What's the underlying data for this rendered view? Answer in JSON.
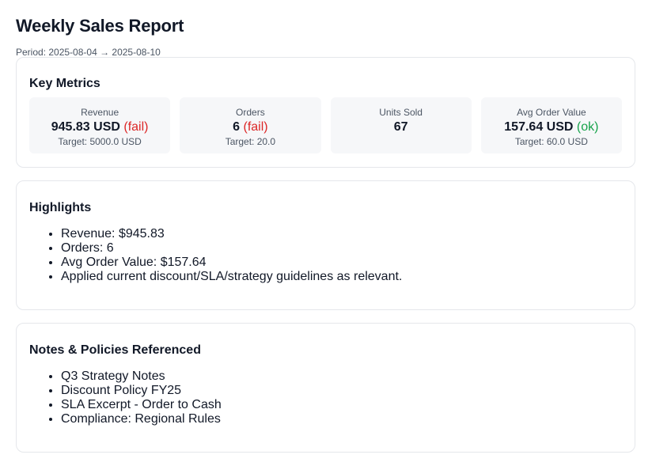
{
  "header": {
    "title": "Weekly Sales Report",
    "period": "Period: 2025-08-04 → 2025-08-10"
  },
  "key_metrics": {
    "title": "Key Metrics",
    "metrics": [
      {
        "label": "Revenue",
        "value": "945.83 USD",
        "status": "(fail)",
        "status_type": "fail",
        "target": "Target: 5000.0 USD"
      },
      {
        "label": "Orders",
        "value": "6",
        "status": "(fail)",
        "status_type": "fail",
        "target": "Target: 20.0"
      },
      {
        "label": "Units Sold",
        "value": "67",
        "status": "",
        "status_type": "",
        "target": ""
      },
      {
        "label": "Avg Order Value",
        "value": "157.64 USD",
        "status": "(ok)",
        "status_type": "ok",
        "target": "Target: 60.0 USD"
      }
    ]
  },
  "highlights": {
    "title": "Highlights",
    "items": [
      "Revenue: $945.83",
      "Orders: 6",
      "Avg Order Value: $157.64",
      "Applied current discount/SLA/strategy guidelines as relevant."
    ]
  },
  "notes": {
    "title": "Notes & Policies Referenced",
    "items": [
      "Q3 Strategy Notes",
      "Discount Policy FY25",
      "SLA Excerpt - Order to Cash",
      "Compliance: Regional Rules"
    ]
  },
  "colors": {
    "fail": "#dc2626",
    "ok": "#16a34a",
    "text": "#111827",
    "muted": "#4b5563",
    "metric_bg": "#f6f7f9",
    "border": "#e5e7eb"
  }
}
